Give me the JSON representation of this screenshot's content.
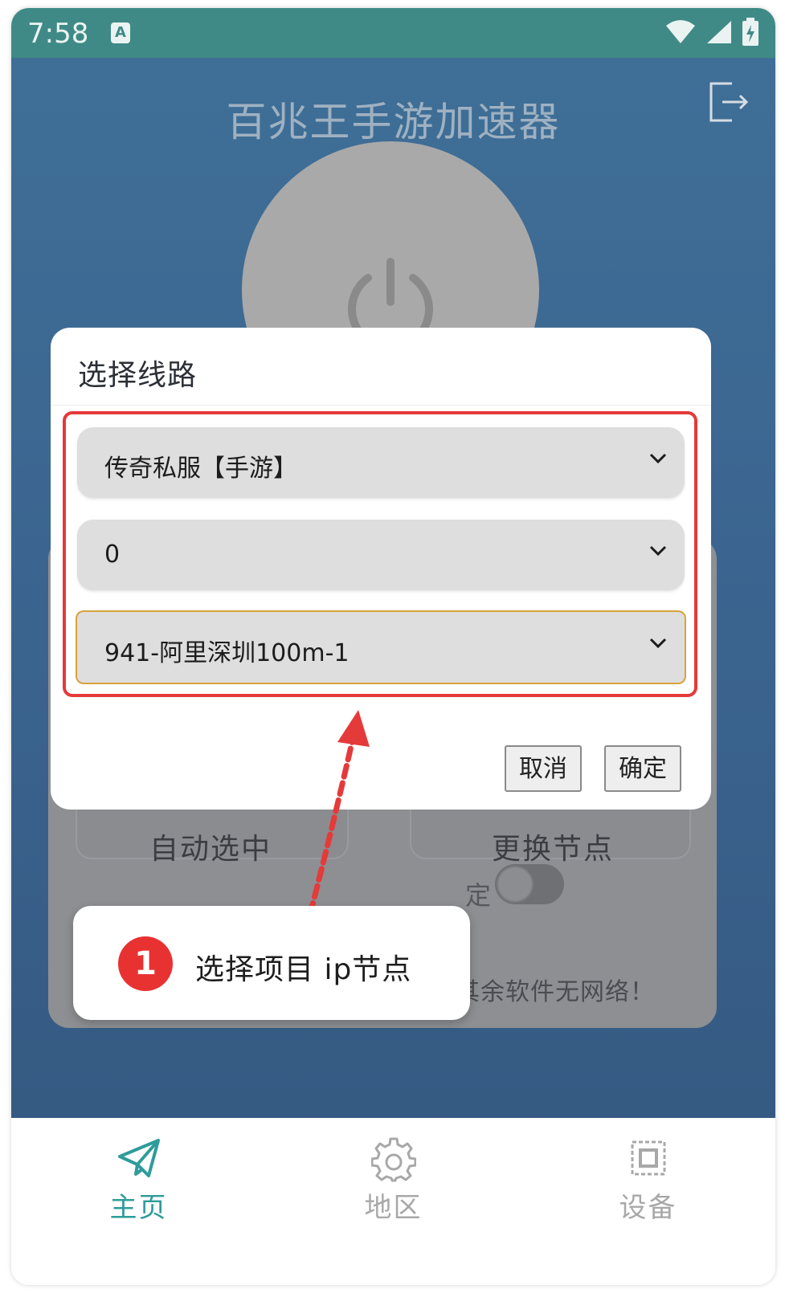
{
  "status_bar": {
    "time": "7:58",
    "indicator": "A"
  },
  "app": {
    "title": "百兆王手游加速器",
    "auto_select": "自动选中",
    "change_node": "更换节点",
    "toggle_label": "定",
    "hint": "提示：仅用于游戏加速使用！其余软件无网络！"
  },
  "dialog": {
    "title": "选择线路",
    "select_game": "传奇私服【手游】",
    "select_region": "0",
    "select_node": "941-阿里深圳100m-1",
    "cancel": "取消",
    "confirm": "确定"
  },
  "callout": {
    "number": "1",
    "text": "选择项目 ip节点"
  },
  "nav": {
    "items": [
      {
        "label": "主页",
        "icon": "paper-plane-icon",
        "active": true
      },
      {
        "label": "地区",
        "icon": "gear-icon",
        "active": false
      },
      {
        "label": "设备",
        "icon": "chip-icon",
        "active": false
      }
    ]
  },
  "colors": {
    "status_bar": "#3f8a86",
    "app_bg": "#3b6590",
    "nav_active": "#2e9c9a",
    "nav_inactive": "#a8a8a8",
    "highlight": "#e53a3a",
    "focus_border": "#d8a23b"
  }
}
